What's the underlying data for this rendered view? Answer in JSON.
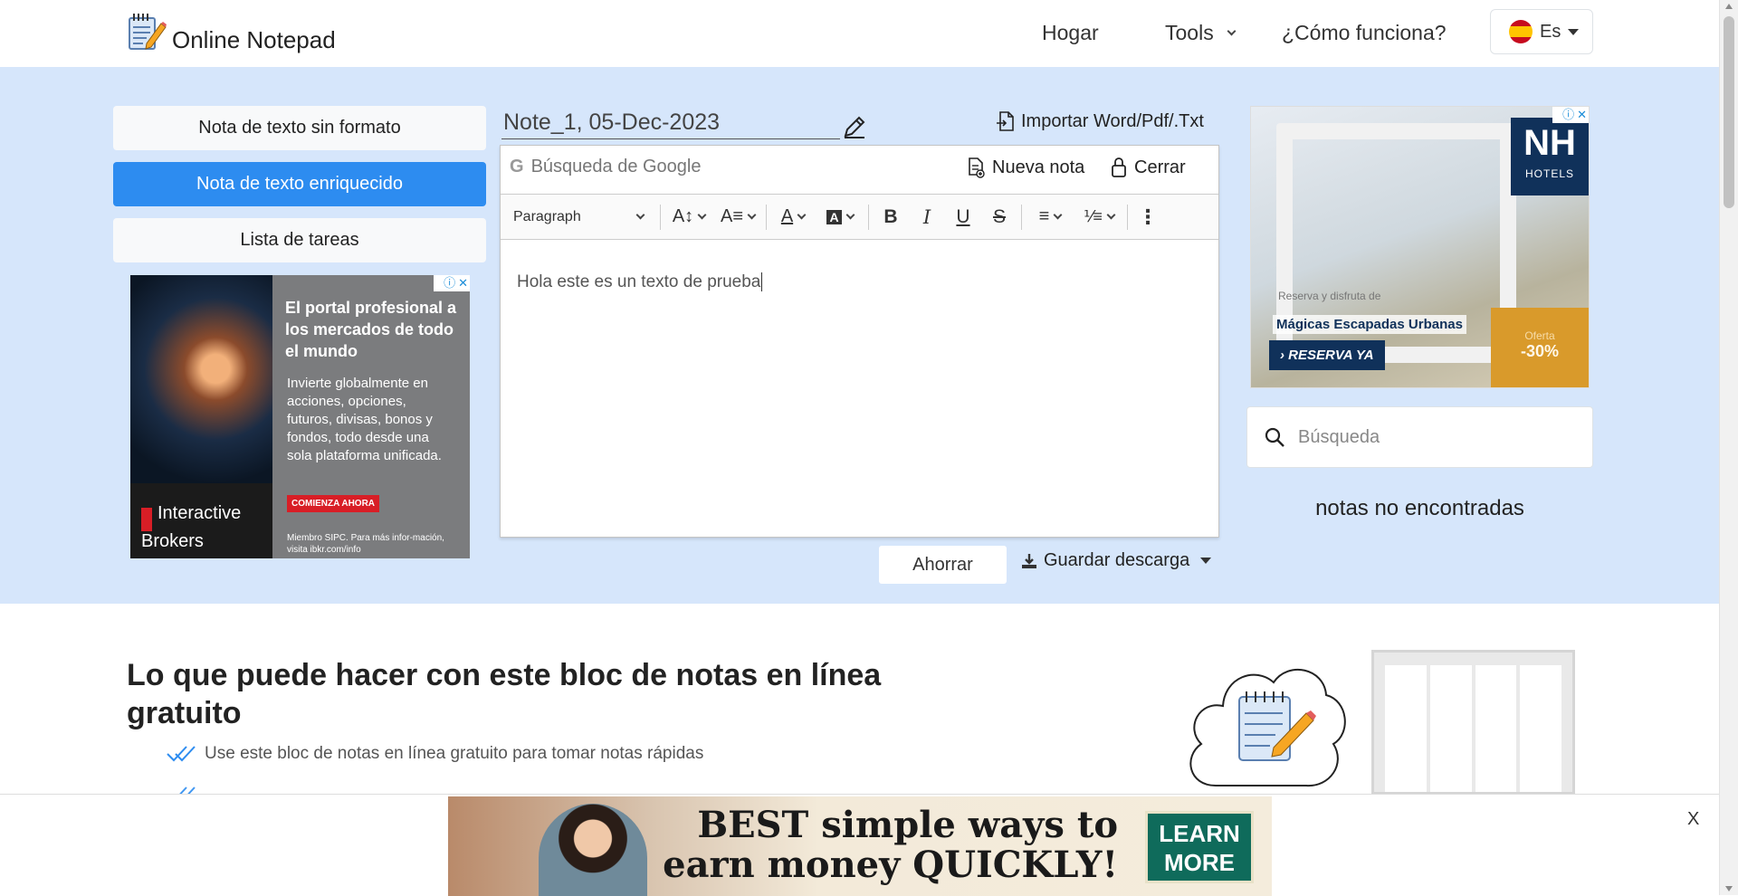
{
  "header": {
    "brand_name": "Online Notepad",
    "nav_home": "Hogar",
    "nav_tools": "Tools",
    "nav_how": "¿Cómo funciona?",
    "lang_label": "Es"
  },
  "left_panel": {
    "buttons": [
      {
        "label": "Nota de texto sin formato",
        "active": false
      },
      {
        "label": "Nota de texto enriquecido",
        "active": true
      },
      {
        "label": "Lista de tareas",
        "active": false
      }
    ]
  },
  "ad_left": {
    "title": "El portal profesional a los mercados de todo el mundo",
    "body": "Invierte globalmente en acciones, opciones, futuros, divisas, bonos y fondos, todo desde una sola plataforma unificada.",
    "cta": "COMIENZA AHORA",
    "brand": "Interactive Brokers",
    "footer": "Miembro SIPC. Para más infor-mación, visita ibkr.com/info"
  },
  "note": {
    "title": "Note_1, 05-Dec-2023",
    "import_label": "Importar Word/Pdf/.Txt",
    "google_placeholder": "Búsqueda de Google",
    "new_note_label": "Nueva nota",
    "close_label": "Cerrar",
    "paragraph_select": "Paragraph",
    "content": "Hola este es un texto de prueba",
    "save_label": "Ahorrar",
    "download_label": "Guardar descarga"
  },
  "ad_right": {
    "brand": "NH",
    "brand_sub": "HOTELS",
    "subline": "Reserva y disfruta de",
    "line": "Mágicas Escapadas Urbanas",
    "cta": "RESERVA YA",
    "offer_label": "Oferta",
    "offer_value": "-30%"
  },
  "search": {
    "placeholder": "Búsqueda",
    "empty_message": "notas no encontradas"
  },
  "section": {
    "heading": "Lo que puede hacer con este bloc de notas en línea gratuito",
    "features": [
      "Use este bloc de notas en línea gratuito para tomar notas rápidas"
    ]
  },
  "bottom_ad": {
    "text": "BEST simple ways to earn money QUICKLY!",
    "cta": "LEARN MORE",
    "close": "X"
  },
  "colors": {
    "accent": "#2d8cf0",
    "band": "#d6e6fb"
  }
}
